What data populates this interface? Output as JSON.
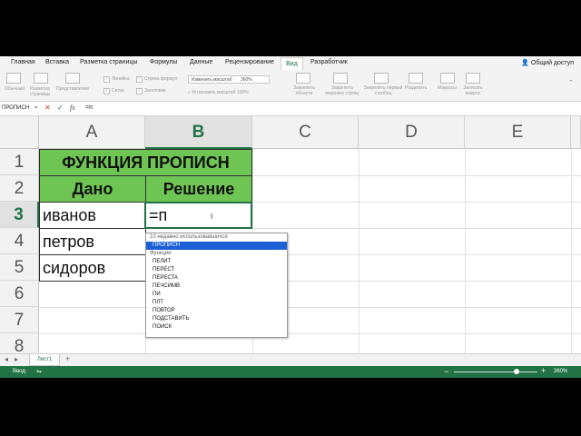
{
  "ribbon_tabs": [
    "Главная",
    "Вставка",
    "Разметка страницы",
    "Формулы",
    "Данные",
    "Рецензирование",
    "Вид",
    "Разработчик"
  ],
  "active_tab": "Вид",
  "share_label": "Общий доступ",
  "ribbon": {
    "normal": "Обычный",
    "page_layout": "Разметка страницы",
    "page_view": "Представление",
    "ruler": "Линейка",
    "formula_bar": "Строка формул",
    "gridlines": "Сетка",
    "headings": "Заголовки",
    "zoom_label": "Изменить масштаб",
    "zoom_value": "360%",
    "zoom_100": "Установить масштаб 100%",
    "freeze_panes": "Закрепить области",
    "freeze_top_row": "Закрепить верхнюю строку",
    "freeze_first_col": "Закрепить первый столбец",
    "split": "Разделить",
    "macros": "Макросы",
    "record_macro": "Записать макрос"
  },
  "formula_bar": {
    "name_box": "ПРОПИСН",
    "cancel_symbol": "✕",
    "enter_symbol": "✓",
    "fx_symbol": "fx",
    "value": "=п"
  },
  "columns": [
    "A",
    "B",
    "C",
    "D",
    "E"
  ],
  "rows": [
    "1",
    "2",
    "3",
    "4",
    "5",
    "6",
    "7",
    "8"
  ],
  "cells": {
    "title": "ФУНКЦИЯ ПРОПИСН",
    "header_given": "Дано",
    "header_solution": "Решение",
    "a3": "иванов",
    "a4": "петров",
    "a5": "сидоров",
    "b3": "=п"
  },
  "autocomplete": {
    "recent_header": "10 недавно использовавшихся",
    "recent_item": "ПРОПИСН",
    "functions_header": "Функции",
    "functions": [
      "ПЕЛИТ",
      "ПЕРЕСТ",
      "ПЕРЕСТА",
      "ПЕЧСИМВ",
      "ПИ",
      "ПЛТ",
      "ПОВТОР",
      "ПОДСТАВИТЬ",
      "ПОИСК"
    ]
  },
  "sheet_tab": "Лист1",
  "add_sheet": "+",
  "status": {
    "mode": "Ввод",
    "zoom": "360%",
    "zoom_level": 0.75
  },
  "colors": {
    "accent": "#217346",
    "header_fill": "#6fc554",
    "highlight": "#1a5fd6"
  }
}
